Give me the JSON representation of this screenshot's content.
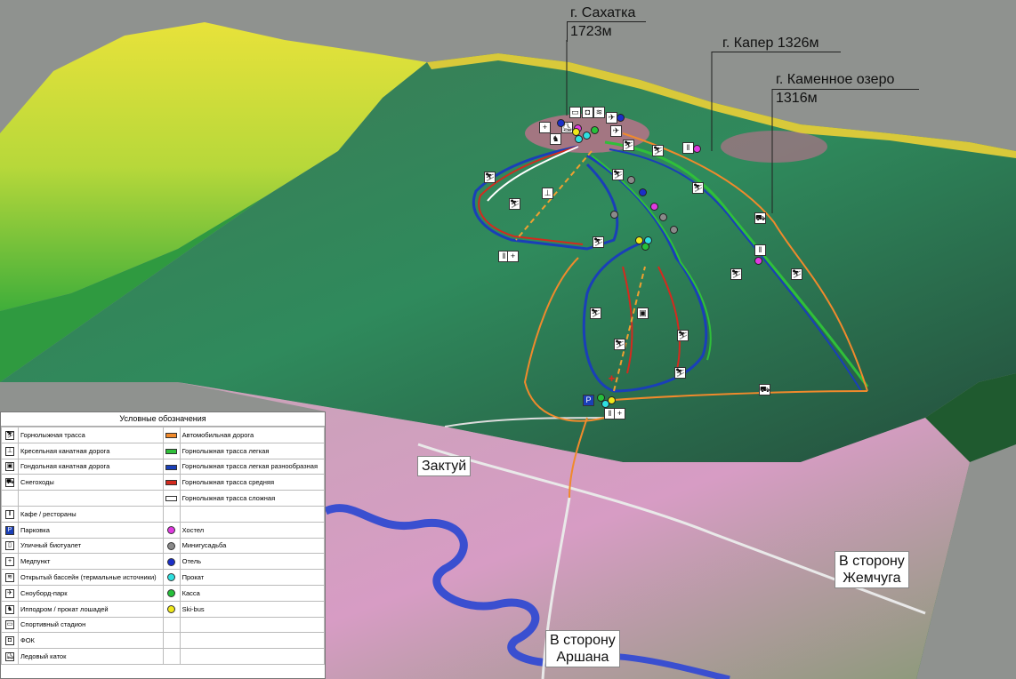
{
  "peaks": [
    {
      "name": "г. Сахатка",
      "height": "1723м"
    },
    {
      "name": "г. Капер 1326м",
      "height": ""
    },
    {
      "name": "г. Каменное озеро",
      "height": "1316м"
    }
  ],
  "places": {
    "village": "Зактуй",
    "toward_zhemchug": [
      "В сторону",
      "Жемчуга"
    ],
    "toward_arshan": [
      "В сторону",
      "Аршана"
    ]
  },
  "legend": {
    "title": "Условные обозначения",
    "left": [
      {
        "icon": "skier-icon",
        "label": "Горнолыжная трасса"
      },
      {
        "icon": "chairlift-icon",
        "label": "Кресельная канатная дорога"
      },
      {
        "icon": "gondola-icon",
        "label": "Гондольная канатная дорога"
      },
      {
        "icon": "snowmobile-icon",
        "label": "Снегоходы"
      },
      {
        "icon": "",
        "label": ""
      },
      {
        "icon": "cafe-icon",
        "label": "Кафе / рестораны"
      },
      {
        "icon": "parking-icon",
        "label": "Парковка"
      },
      {
        "icon": "toilet-icon",
        "label": "Уличный биотуалет"
      },
      {
        "icon": "medical-icon",
        "label": "Медпункт"
      },
      {
        "icon": "pool-icon",
        "label": "Открытый бассейн (термальные источники)"
      },
      {
        "icon": "snowboard-icon",
        "label": "Сноуборд-парк"
      },
      {
        "icon": "horse-icon",
        "label": "Ипподром / прокат лошадей"
      },
      {
        "icon": "stadium-icon",
        "label": "Спортивный стадион"
      },
      {
        "icon": "fok-icon",
        "label": "ФОК"
      },
      {
        "icon": "skating-icon",
        "label": "Ледовый каток"
      }
    ],
    "right": [
      {
        "kind": "bar",
        "color": "#f08a2c",
        "label": "Автомобильная дорога"
      },
      {
        "kind": "bar",
        "color": "#2fbf3a",
        "label": "Горнолыжная трасса легкая"
      },
      {
        "kind": "bar",
        "color": "#1a3fb8",
        "label": "Горнолыжная трасса легкая разнообразная"
      },
      {
        "kind": "bar",
        "color": "#d42a1e",
        "label": "Горнолыжная трасса средняя"
      },
      {
        "kind": "bar",
        "color": "#ffffff",
        "label": "Горнолыжная трасса сложная"
      },
      {
        "kind": "none",
        "color": "",
        "label": ""
      },
      {
        "kind": "circle",
        "color": "#e03ae0",
        "label": "Хостел"
      },
      {
        "kind": "circle",
        "color": "#8a8a8a",
        "label": "Минигусадьба"
      },
      {
        "kind": "circle",
        "color": "#1a2ec8",
        "label": "Отель"
      },
      {
        "kind": "circle",
        "color": "#2ee0e0",
        "label": "Прокат"
      },
      {
        "kind": "circle",
        "color": "#26c03a",
        "label": "Касса"
      },
      {
        "kind": "circle",
        "color": "#f0e81a",
        "label": "Ski-bus"
      },
      {
        "kind": "none",
        "color": "",
        "label": ""
      },
      {
        "kind": "none",
        "color": "",
        "label": ""
      },
      {
        "kind": "none",
        "color": "",
        "label": ""
      }
    ]
  }
}
